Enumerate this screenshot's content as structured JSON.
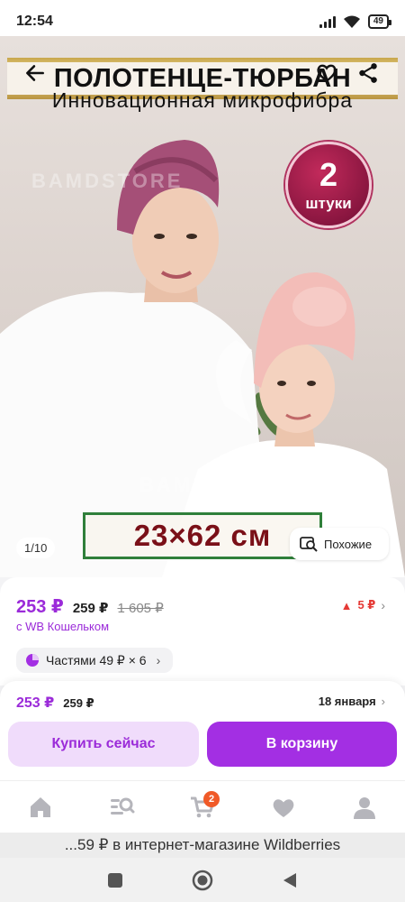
{
  "status_bar": {
    "time": "12:54",
    "battery": "49"
  },
  "hero": {
    "banner_title": "ПОЛОТЕНЦЕ-ТЮРБАН",
    "subtitle": "Инновационная  микрофибра",
    "badge_number": "2",
    "badge_text": "штуки",
    "watermark": "BAMDSTORE",
    "size_text": "23×62 см",
    "image_counter": "1/10",
    "similar_label": "Похожие"
  },
  "price": {
    "main": "253 ₽",
    "second": "259 ₽",
    "old": "1 605 ₽",
    "note": "с WB Кошельком",
    "change": "5 ₽",
    "installment": "Частями 49 ₽ × 6"
  },
  "buy_bar": {
    "price": "253 ₽",
    "price2": "259 ₽",
    "delivery": "18 января",
    "buy_now": "Купить сейчас",
    "add_to_cart": "В корзину"
  },
  "tabbar": {
    "cart_count": "2"
  },
  "browser": {
    "title": "...59 ₽ в интернет-магазине Wildberries"
  },
  "colors": {
    "accent": "#a32fe3",
    "price": "#9b2bd9",
    "badge": "#f05a28"
  }
}
